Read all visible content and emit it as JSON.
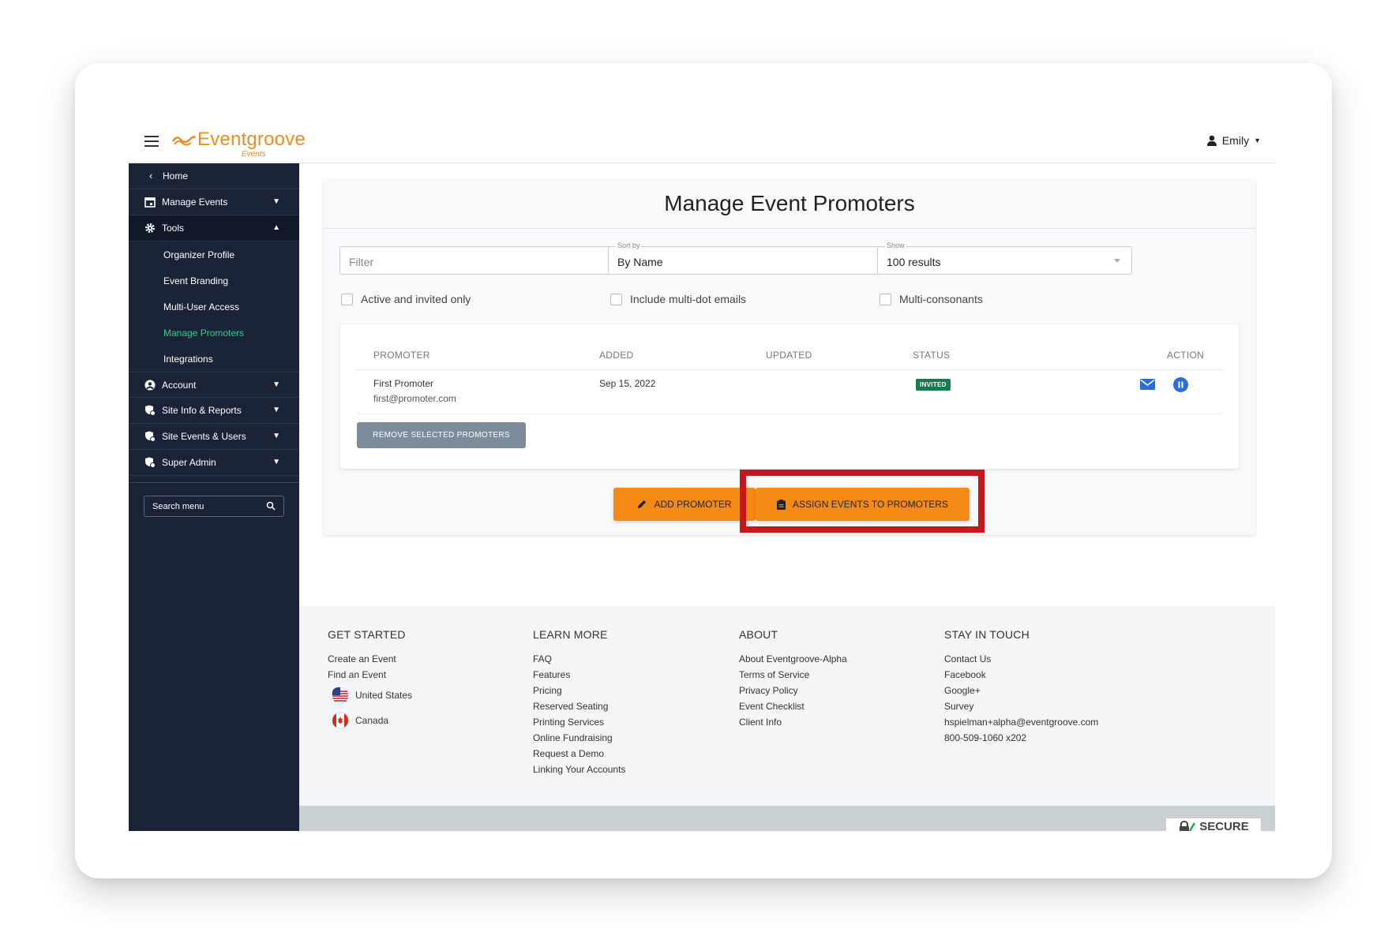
{
  "header": {
    "logo_text": "Eventgroove",
    "logo_sub": "Events",
    "user_name": "Emily"
  },
  "sidebar": {
    "home_label": "Home",
    "items": [
      {
        "label": "Manage Events",
        "icon": "calendar-icon"
      },
      {
        "label": "Tools",
        "icon": "gear-icon"
      },
      {
        "label": "Account",
        "icon": "user-circle-icon"
      },
      {
        "label": "Site Info & Reports",
        "icon": "shield-gear-icon"
      },
      {
        "label": "Site Events & Users",
        "icon": "shield-gear-icon"
      },
      {
        "label": "Super Admin",
        "icon": "shield-gear-icon"
      }
    ],
    "tools_sub": [
      "Organizer Profile",
      "Event Branding",
      "Multi-User Access",
      "Manage Promoters",
      "Integrations"
    ],
    "current_sub": "Manage Promoters",
    "search_placeholder": "Search menu"
  },
  "main": {
    "title": "Manage Event Promoters",
    "filter_placeholder": "Filter",
    "sort_label": "Sort by",
    "sort_value": "By Name",
    "show_label": "Show",
    "show_value": "100 results",
    "checkboxes": [
      "Active and invited only",
      "Include multi-dot emails",
      "Multi-consonants"
    ],
    "table": {
      "headers": [
        "PROMOTER",
        "ADDED",
        "UPDATED",
        "STATUS",
        "ACTION"
      ],
      "rows": [
        {
          "name": "First Promoter",
          "email": "first@promoter.com",
          "added": "Sep 15, 2022",
          "updated": "",
          "status": "INVITED"
        }
      ]
    },
    "remove_button": "REMOVE SELECTED PROMOTERS",
    "add_button": "ADD PROMOTER",
    "assign_button": "ASSIGN EVENTS TO PROMOTERS"
  },
  "footer": {
    "columns": [
      {
        "heading": "GET STARTED",
        "links": [
          "Create an Event",
          "Find an Event"
        ]
      },
      {
        "heading": "LEARN MORE",
        "links": [
          "FAQ",
          "Features",
          "Pricing",
          "Reserved Seating",
          "Printing Services",
          "Online Fundraising",
          "Request a Demo",
          "Linking Your Accounts"
        ]
      },
      {
        "heading": "ABOUT",
        "links": [
          "About Eventgroove-Alpha",
          "Terms of Service",
          "Privacy Policy",
          "Event Checklist",
          "Client Info"
        ]
      },
      {
        "heading": "STAY IN TOUCH",
        "links": [
          "Contact Us",
          "Facebook",
          "Google+",
          "Survey",
          "hspielman+alpha@eventgroove.com",
          "800-509-1060 x202"
        ]
      }
    ],
    "countries": [
      "United States",
      "Canada"
    ],
    "secure_label": "SECURE"
  },
  "colors": {
    "brand_orange": "#f58a14",
    "sidebar_bg": "#1b2437",
    "active_green": "#2ecc8f",
    "status_green": "#1a7a4f",
    "highlight_red": "#c8161d"
  }
}
